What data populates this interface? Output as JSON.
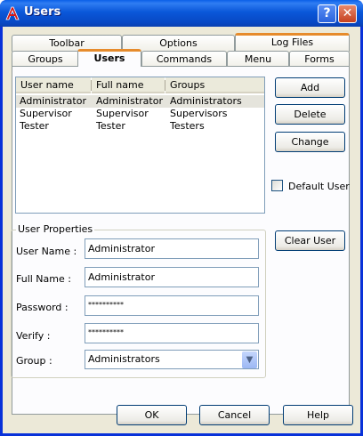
{
  "window": {
    "title": "Users",
    "help_glyph": "?",
    "close_glyph": "✕",
    "title_color": "#0a57d9"
  },
  "tabs": {
    "row1": [
      {
        "label": "Toolbar"
      },
      {
        "label": "Options"
      },
      {
        "label": "Log Files"
      }
    ],
    "row2": [
      {
        "label": "Groups"
      },
      {
        "label": "Users",
        "active": true
      },
      {
        "label": "Commands"
      },
      {
        "label": "Menu"
      },
      {
        "label": "Forms"
      }
    ]
  },
  "user_list": {
    "columns": [
      "User name",
      "Full name",
      "Groups"
    ],
    "rows": [
      [
        "Administrator",
        "Administrator",
        "Administrators"
      ],
      [
        "Supervisor",
        "Supervisor",
        "Supervisors"
      ],
      [
        "Tester",
        "Tester",
        "Testers"
      ]
    ],
    "selected_row": 0
  },
  "buttons": {
    "add": "Add",
    "delete": "Delete",
    "change": "Change",
    "clear_user": "Clear User",
    "ok": "OK",
    "cancel": "Cancel",
    "help": "Help"
  },
  "default_user": {
    "label": "Default User",
    "checked": false
  },
  "user_properties": {
    "legend": "User Properties",
    "user_name_label": "User Name :",
    "user_name_value": "Administrator",
    "full_name_label": "Full Name :",
    "full_name_value": "Administrator",
    "password_label": "Password :",
    "password_value": "**********",
    "verify_label": "Verify :",
    "verify_value": "**********",
    "group_label": "Group :",
    "group_value": "Administrators"
  },
  "icons": {
    "app": "app-logo-icon",
    "dropdown": "chevron-down-icon"
  },
  "colors": {
    "titlebar": "#0a57d9",
    "active_tab_accent": "#e68b2c",
    "dialog_face": "#ece9d8"
  }
}
